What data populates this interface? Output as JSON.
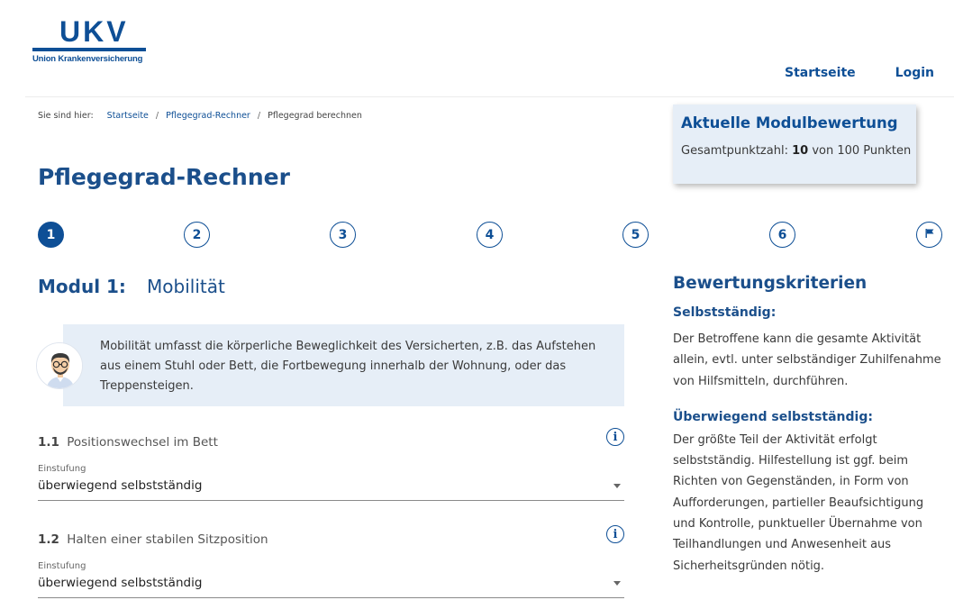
{
  "logo": {
    "brand": "UKV",
    "subtitle": "Union Krankenversicherung"
  },
  "nav": {
    "home": "Startseite",
    "login": "Login"
  },
  "breadcrumb": {
    "prefix": "Sie sind hier:",
    "items": [
      "Startseite",
      "Pflegegrad-Rechner",
      "Pflegegrad berechnen"
    ]
  },
  "score": {
    "title": "Aktuelle Modulbewertung",
    "label": "Gesamtpunktzahl:",
    "value": "10",
    "suffix": "von 100 Punkten"
  },
  "page": {
    "title": "Pflegegrad-Rechner"
  },
  "stepper": {
    "steps": [
      "1",
      "2",
      "3",
      "4",
      "5",
      "6"
    ],
    "active_step": 1,
    "final_icon": "flag-icon"
  },
  "module": {
    "number": "Modul 1:",
    "name": "Mobilität",
    "info": "Mobilität umfasst die körperliche Beweglichkeit des Versicherten, z.B. das Aufstehen aus einem Stuhl oder Bett, die Fortbewegung innerhalb der Wohnung, oder das Treppensteigen."
  },
  "questions": [
    {
      "number": "1.1",
      "label": "Positionswechsel im Bett",
      "caption": "Einstufung",
      "value": "überwiegend selbstständig"
    },
    {
      "number": "1.2",
      "label": "Halten einer stabilen Sitzposition",
      "caption": "Einstufung",
      "value": "überwiegend selbstständig"
    }
  ],
  "criteria": {
    "title": "Bewertungskriterien",
    "items": [
      {
        "heading": "Selbstständig:",
        "text": "Der Betroffene kann die gesamte Aktivität allein, evtl. unter selbständiger Zuhilfenahme von Hilfsmitteln, durchführen."
      },
      {
        "heading": "Überwiegend selbstständig:",
        "text": "Der größte Teil der Aktivität erfolgt selbstständig. Hilfestellung ist ggf. beim Richten von Gegenständen, in Form von Aufforderungen, partieller Beaufsichtigung und Kontrolle, punktueller Übernahme von Teilhandlungen und Anwesenheit aus Sicherheitsgründen nötig."
      }
    ]
  },
  "colors": {
    "primary": "#0e4f96",
    "title": "#1b4f8b",
    "panel": "#e6eef7"
  }
}
